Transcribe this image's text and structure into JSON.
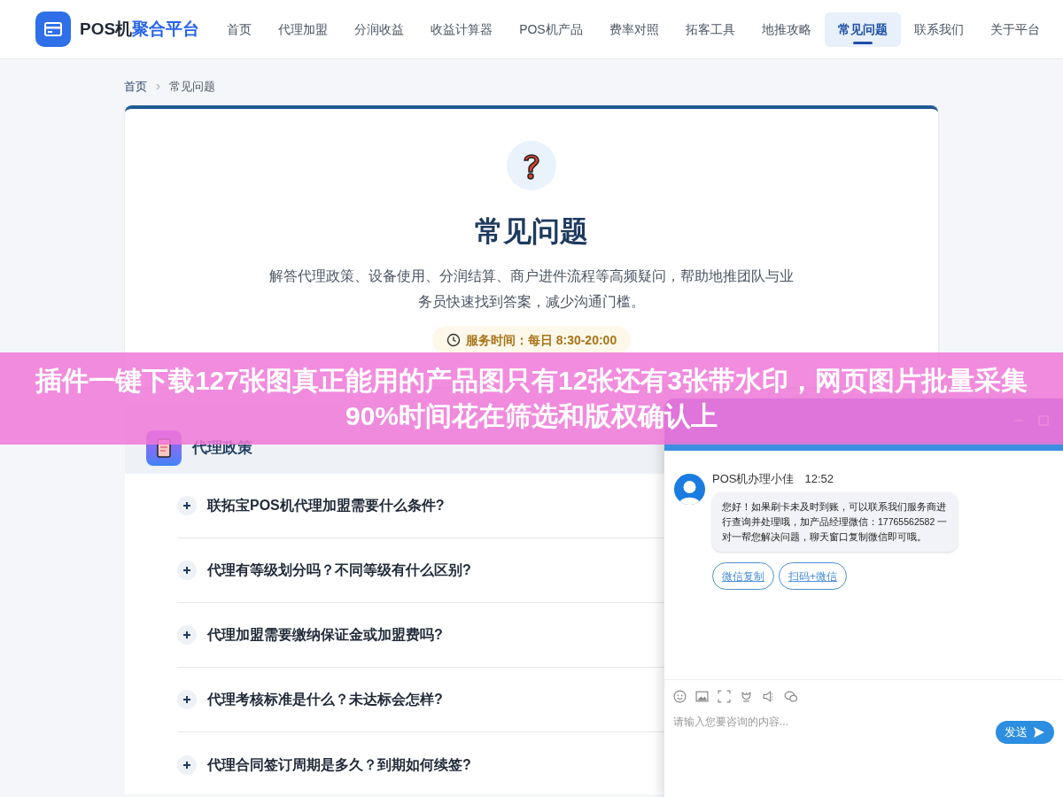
{
  "header": {
    "logo": {
      "brand": "POS机",
      "accent": "聚合平台"
    },
    "nav": [
      {
        "label": "首页",
        "selected": false
      },
      {
        "label": "代理加盟",
        "selected": false
      },
      {
        "label": "分润收益",
        "selected": false
      },
      {
        "label": "收益计算器",
        "selected": false
      },
      {
        "label": "POS机产品",
        "selected": false
      },
      {
        "label": "费率对照",
        "selected": false
      },
      {
        "label": "拓客工具",
        "selected": false
      },
      {
        "label": "地推攻略",
        "selected": false
      },
      {
        "label": "常见问题",
        "selected": true
      },
      {
        "label": "联系我们",
        "selected": false
      },
      {
        "label": "关于平台",
        "selected": false
      }
    ]
  },
  "breadcrumb": [
    "首页",
    "常见问题"
  ],
  "hero": {
    "title": "常见问题",
    "description": "解答代理政策、设备使用、分润结算、商户进件流程等高频疑问，帮助地推团队与业务员快速找到答案，减少沟通门槛。",
    "hours": "服务时间：每日 8:30-20:00"
  },
  "section": {
    "title": "代理政策",
    "questions": [
      {
        "text": "联拓宝POS机代理加盟需要什么条件?",
        "expanded": false
      },
      {
        "text": "代理有等级划分吗？不同等级有什么区别?",
        "expanded": false
      },
      {
        "text": "代理加盟需要缴纳保证金或加盟费吗?",
        "expanded": false
      },
      {
        "text": "代理考核标准是什么？未达标会怎样?",
        "expanded": false
      },
      {
        "text": "代理合同签订周期是多久？到期如何续签?",
        "expanded": false
      }
    ]
  },
  "banner": {
    "text": "插件一键下载127张图真正能用的产品图只有12张还有3张带水印，网页图片批量采集90%时间花在筛选和版权确认上"
  },
  "chat": {
    "agent": "POS机办理小佳",
    "time": "12:52",
    "message": "您好！如果刷卡未及时到账，可以联系我们服务商进行查询并处理哦，加产品经理微信：17765562582 一对一帮您解决问题，聊天窗口复制微信即可哦。",
    "actions": [
      "微信复制",
      "扫码+微信"
    ],
    "input": {
      "placeholder": "请输入您要咨询的内容..."
    },
    "send": "发送"
  }
}
